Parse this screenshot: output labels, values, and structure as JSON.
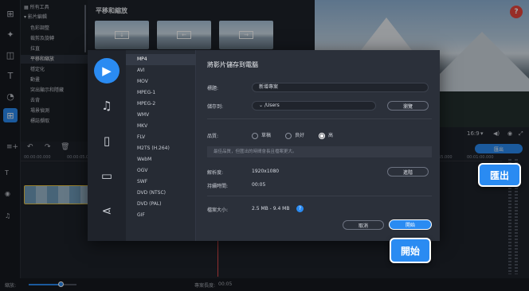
{
  "tools": {
    "items": [
      {
        "label": "所有工具",
        "header": true
      },
      {
        "label": "影片編輯",
        "header": true
      },
      {
        "label": "色彩調整"
      },
      {
        "label": "裁剪及旋轉"
      },
      {
        "label": "拉直"
      },
      {
        "label": "平移和縮放",
        "selected": true
      },
      {
        "label": "穩定化"
      },
      {
        "label": "動畫"
      },
      {
        "label": "突出顯示和隱藏"
      },
      {
        "label": "去背"
      },
      {
        "label": "場景偵測"
      },
      {
        "label": "標誌擷取"
      }
    ]
  },
  "panel": {
    "title": "平移和縮放"
  },
  "help_label": "?",
  "preview_controls": {
    "ratio": "16:9"
  },
  "timeline": {
    "export_label": "匯出",
    "ruler": [
      "00:00:00.000",
      "00:00:05.000",
      "00:00:55.000",
      "00:01:00.000"
    ]
  },
  "status": {
    "zoom_label": "縮放:",
    "duration_label": "專案長度:",
    "duration_value": "00:05"
  },
  "dialog": {
    "title": "將影片儲存到電腦",
    "categories": [
      "video",
      "audio",
      "devices",
      "tv",
      "share"
    ],
    "formats": [
      "MP4",
      "AVI",
      "MOV",
      "MPEG-1",
      "MPEG-2",
      "WMV",
      "MKV",
      "FLV",
      "M2TS (H.264)",
      "WebM",
      "OGV",
      "SWF",
      "DVD (NTSC)",
      "DVD (PAL)",
      "GIF"
    ],
    "selected_format": "MP4",
    "title_label": "標題:",
    "title_value": "新增專案",
    "saveto_label": "儲存到:",
    "saveto_value": "/Users",
    "browse_label": "瀏覽",
    "quality_label": "品質:",
    "quality_options": [
      "草稿",
      "良好",
      "高"
    ],
    "quality_selected": "高",
    "note": "最佳品質，但匯出的時間會長且檔案更大。",
    "resolution_label": "解析度:",
    "resolution_value": "1920x1080",
    "advanced_label": "進階",
    "duration_label": "持續時間:",
    "duration_value": "00:05",
    "filesize_label": "檔案大小:",
    "filesize_value": "2.5 MB - 9.4 MB",
    "cancel_label": "取消",
    "start_label": "開始"
  },
  "callouts": {
    "export": "匯出",
    "start": "開始"
  }
}
